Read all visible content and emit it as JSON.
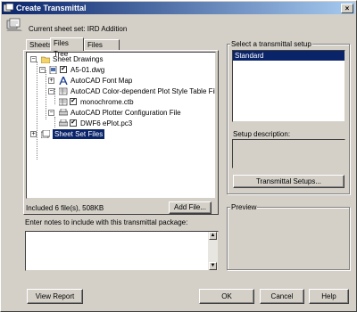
{
  "window": {
    "title": "Create Transmittal"
  },
  "title_buttons": {
    "close": "×"
  },
  "header": {
    "current_sheet_set": "Current sheet set: IRD Addition"
  },
  "tabs": [
    {
      "label": "Sheets"
    },
    {
      "label": "Files Tree"
    },
    {
      "label": "Files Table"
    }
  ],
  "tree": {
    "nodes": [
      {
        "label": "Sheet Drawings",
        "expander": "−"
      },
      {
        "label": "A5-01.dwg",
        "expander": "−",
        "checked": "✔"
      },
      {
        "label": "AutoCAD Font Map",
        "expander": "+"
      },
      {
        "label": "AutoCAD Color-dependent Plot Style Table File",
        "expander": "−"
      },
      {
        "label": "monochrome.ctb",
        "checked": "✔"
      },
      {
        "label": "AutoCAD Plotter Configuration File",
        "expander": "−"
      },
      {
        "label": "DWF6 ePlot.pc3",
        "checked": "✔"
      },
      {
        "label": "Sheet Set Files",
        "expander": "+"
      }
    ]
  },
  "summary": {
    "included": "Included 6 file(s), 508KB",
    "add_file": "Add File..."
  },
  "notes": {
    "label": "Enter notes to include with this transmittal package:",
    "value": ""
  },
  "setup": {
    "group_label": "Select a transmittal setup",
    "items": [
      "Standard"
    ],
    "description_label": "Setup description:",
    "description_value": "",
    "setups_button": "Transmittal Setups..."
  },
  "preview": {
    "label": "Preview"
  },
  "footer": {
    "view_report": "View Report",
    "ok": "OK",
    "cancel": "Cancel",
    "help": "Help"
  },
  "colors": {
    "title_start": "#0a246a",
    "title_end": "#a6caf0",
    "selection": "#0a246a",
    "face": "#d4d0c8"
  }
}
